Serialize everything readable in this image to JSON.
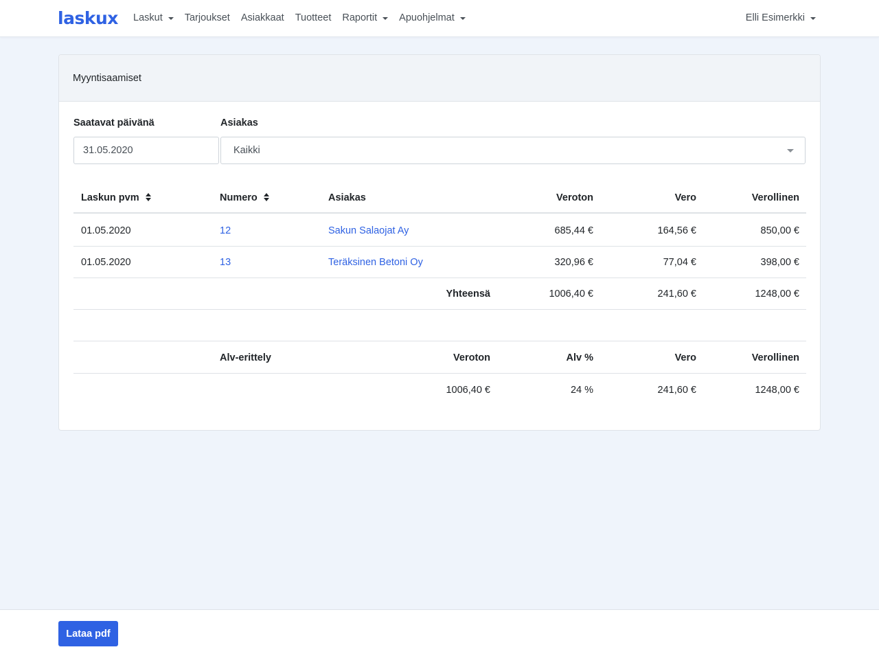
{
  "nav": {
    "brand": "laskux",
    "items": [
      {
        "label": "Laskut",
        "dropdown": true
      },
      {
        "label": "Tarjoukset",
        "dropdown": false
      },
      {
        "label": "Asiakkaat",
        "dropdown": false
      },
      {
        "label": "Tuotteet",
        "dropdown": false
      },
      {
        "label": "Raportit",
        "dropdown": true
      },
      {
        "label": "Apuohjelmat",
        "dropdown": true
      }
    ],
    "user": "Elli Esimerkki"
  },
  "card": {
    "title": "Myyntisaamiset"
  },
  "filters": {
    "date_label": "Saatavat päivänä",
    "date_value": "31.05.2020",
    "customer_label": "Asiakas",
    "customer_value": "Kaikki"
  },
  "invoices": {
    "headers": {
      "date": "Laskun pvm",
      "number": "Numero",
      "customer": "Asiakas",
      "net": "Veroton",
      "tax": "Vero",
      "gross": "Verollinen"
    },
    "rows": [
      {
        "date": "01.05.2020",
        "number": "12",
        "customer": "Sakun Salaojat Ay",
        "net": "685,44 €",
        "tax": "164,56 €",
        "gross": "850,00 €"
      },
      {
        "date": "01.05.2020",
        "number": "13",
        "customer": "Teräksinen Betoni Oy",
        "net": "320,96 €",
        "tax": "77,04 €",
        "gross": "398,00 €"
      }
    ],
    "total": {
      "label": "Yhteensä",
      "net": "1006,40 €",
      "tax": "241,60 €",
      "gross": "1248,00 €"
    }
  },
  "vat": {
    "headers": {
      "title": "Alv-erittely",
      "net": "Veroton",
      "rate": "Alv %",
      "tax": "Vero",
      "gross": "Verollinen"
    },
    "rows": [
      {
        "net": "1006,40 €",
        "rate": "24 %",
        "tax": "241,60 €",
        "gross": "1248,00 €"
      }
    ]
  },
  "footer": {
    "pdf_button": "Lataa pdf"
  }
}
